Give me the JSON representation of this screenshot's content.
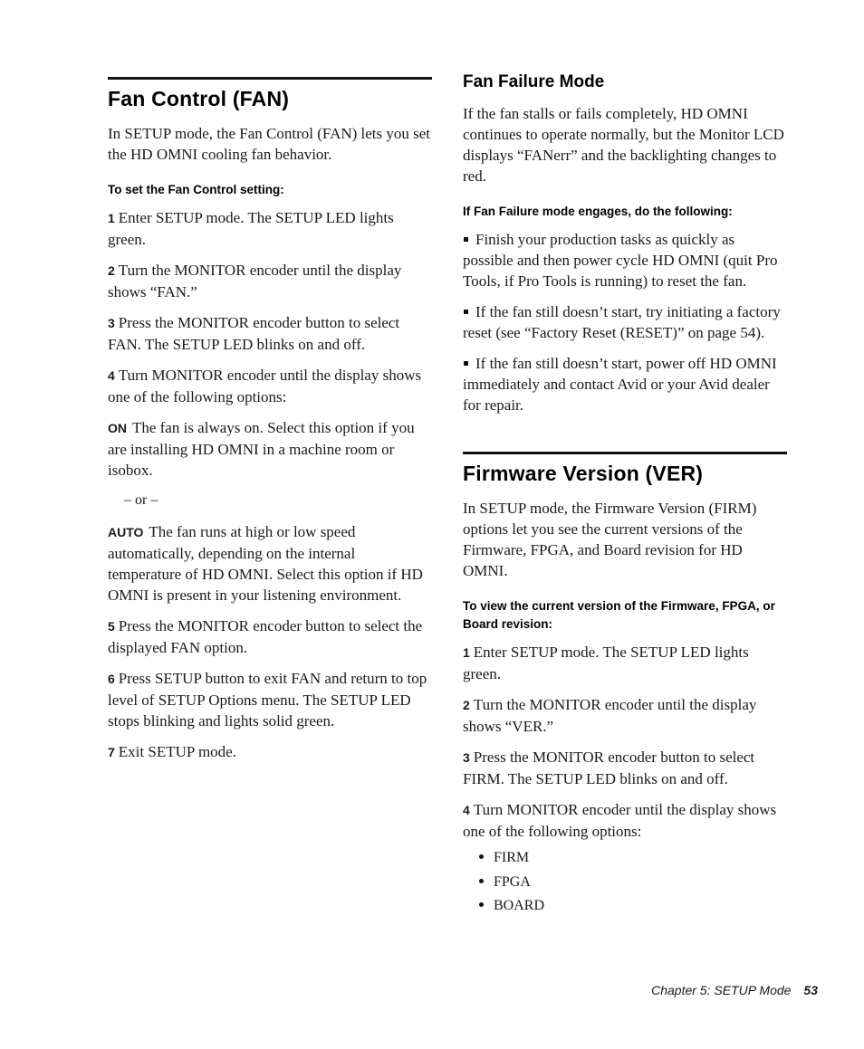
{
  "left": {
    "heading": "Fan Control (FAN)",
    "intro": "In SETUP mode, the Fan Control (FAN) lets you set the HD OMNI cooling fan behavior.",
    "procedure_title": "To set the Fan Control setting:",
    "steps": [
      {
        "num": "1",
        "text": "Enter SETUP mode. The SETUP LED lights green."
      },
      {
        "num": "2",
        "text": "Turn the MONITOR encoder until the display shows “FAN.”"
      },
      {
        "num": "3",
        "text": "Press the MONITOR encoder button to select FAN. The SETUP LED blinks on and off."
      },
      {
        "num": "4",
        "text": "Turn MONITOR encoder until the display shows one of the following options:"
      }
    ],
    "options": [
      {
        "term": "ON",
        "text": "The fan is always on. Select this option if you are installing HD OMNI in a machine room or isobox."
      },
      {
        "term": "AUTO",
        "text": "The fan runs at high or low speed automatically, depending on the internal temperature of HD OMNI. Select this option if HD OMNI is present in your listening environment."
      }
    ],
    "or_text": "– or –",
    "steps_after": [
      {
        "num": "5",
        "text": "Press the MONITOR encoder button to select the displayed FAN option."
      },
      {
        "num": "6",
        "text": "Press SETUP button to exit FAN and return to top level of SETUP Options menu. The SETUP LED stops blinking and lights solid green."
      },
      {
        "num": "7",
        "text": "Exit SETUP mode."
      }
    ]
  },
  "right": {
    "failure": {
      "heading": "Fan Failure Mode",
      "intro": "If the fan stalls or fails completely, HD OMNI continues to operate normally, but the Monitor LCD displays “FANerr” and the backlighting changes to red.",
      "procedure_title": "If Fan Failure mode engages, do the following:",
      "bullets": [
        "Finish your production tasks as quickly as possible and then power cycle HD OMNI (quit Pro Tools, if Pro Tools is running) to reset the fan.",
        "If the fan still doesn’t start, try initiating a factory reset (see “Factory Reset (RESET)” on page 54).",
        "If the fan still doesn’t start, power off HD OMNI immediately and contact Avid or your Avid dealer for repair."
      ]
    },
    "firmware": {
      "heading": "Firmware Version (VER)",
      "intro": "In SETUP mode, the Firmware Version (FIRM) options let you see the current versions of the Firmware, FPGA, and Board revision for HD OMNI.",
      "procedure_title": "To view the current version of the Firmware, FPGA, or Board revision:",
      "steps": [
        {
          "num": "1",
          "text": "Enter SETUP mode. The SETUP LED lights green."
        },
        {
          "num": "2",
          "text": "Turn the MONITOR encoder until the display shows “VER.”"
        },
        {
          "num": "3",
          "text": "Press the MONITOR encoder button to select FIRM. The SETUP LED blinks on and off."
        },
        {
          "num": "4",
          "text": "Turn MONITOR encoder until the display shows one of the following options:"
        }
      ],
      "options": [
        "FIRM",
        "FPGA",
        "BOARD"
      ]
    }
  },
  "footer": {
    "chapter": "Chapter 5: SETUP Mode",
    "page": "53"
  }
}
